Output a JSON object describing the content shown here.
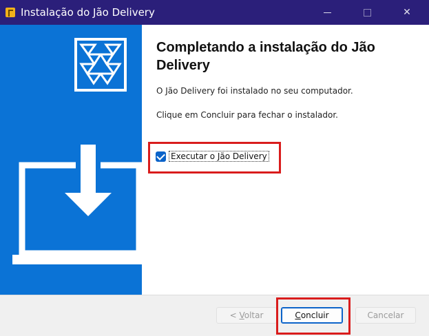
{
  "window": {
    "title": "Instalação do Jão Delivery",
    "controls": {
      "minimize_icon": "minimize-icon",
      "maximize_icon": "maximize-icon",
      "close_icon": "close-icon",
      "close_glyph": "✕"
    }
  },
  "content": {
    "heading": "Completando a instalação do Jão Delivery",
    "paragraph_installed": "O Jão Delivery foi instalado no seu computador.",
    "paragraph_close": "Clique em Concluir para fechar o instalador.",
    "run_checkbox": {
      "label": "Executar o Jão Delivery",
      "checked": true
    }
  },
  "footer": {
    "back_prefix": "< ",
    "back_underlined": "V",
    "back_rest": "oltar",
    "finish_underlined": "C",
    "finish_rest": "oncluir",
    "cancel_label": "Cancelar"
  },
  "colors": {
    "titlebar": "#2b1f7a",
    "sidebar": "#0b73d6",
    "highlight": "#d91c1c",
    "checkbox": "#0b63c9"
  }
}
